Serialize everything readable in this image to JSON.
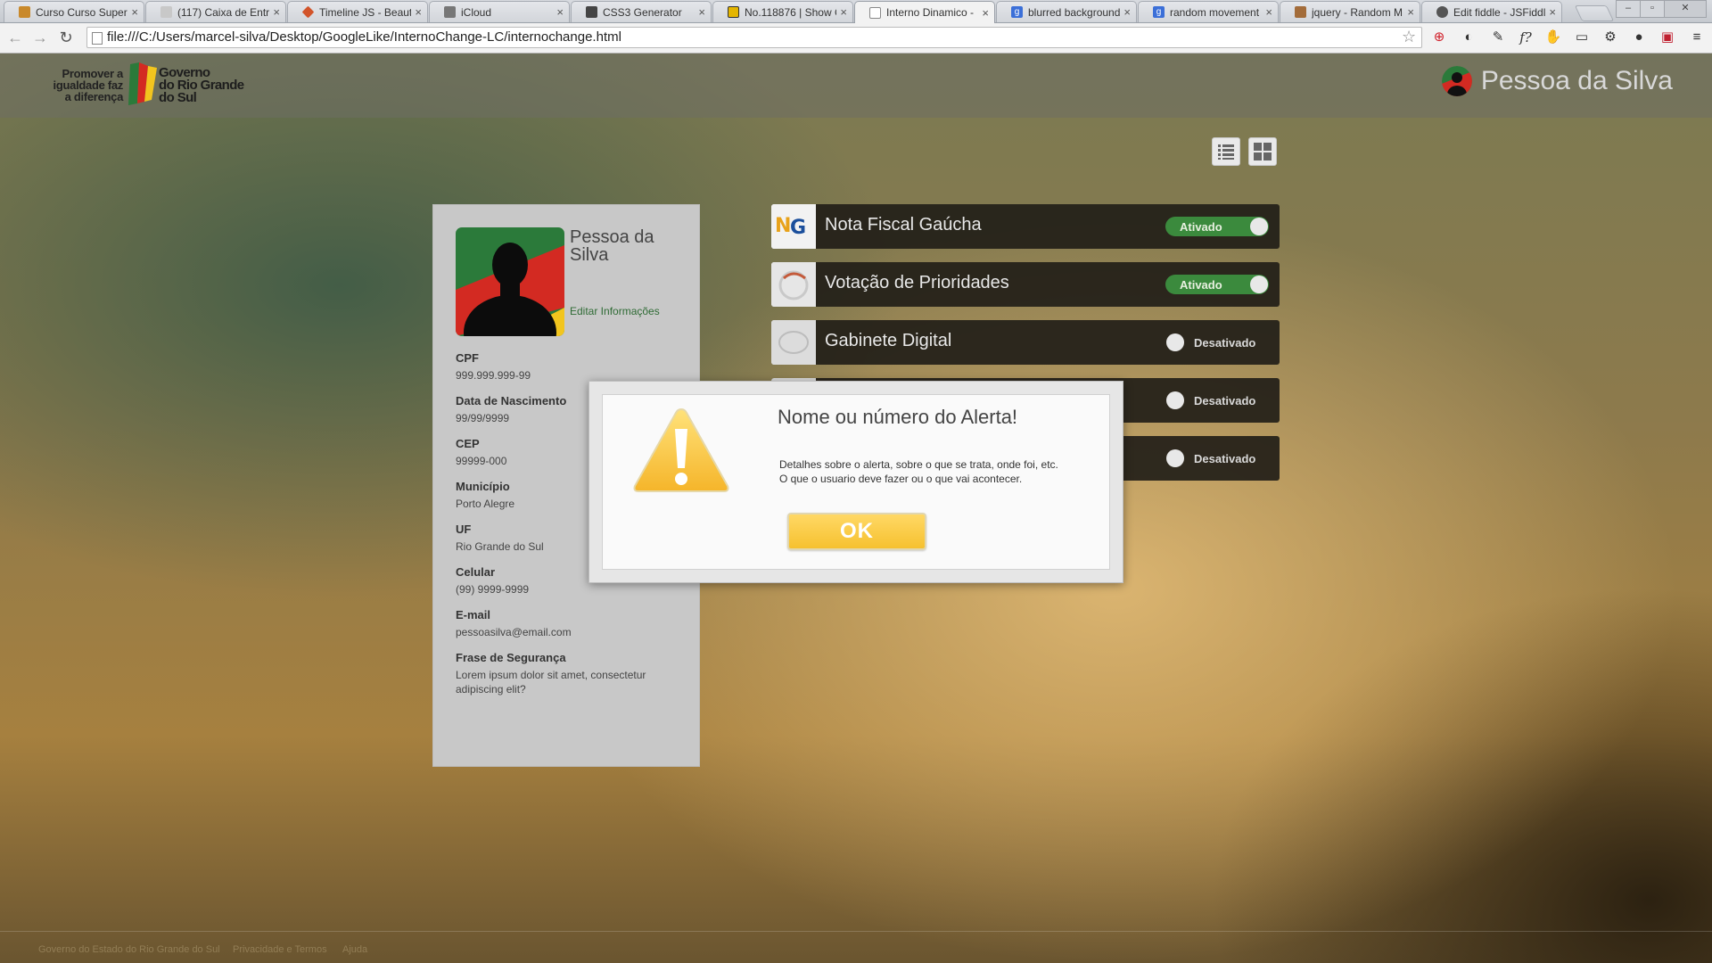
{
  "browser": {
    "tabs": [
      {
        "label": "Curso Curso Superi",
        "fav_color": "#c9892b",
        "active": false
      },
      {
        "label": "(117) Caixa de Entra",
        "fav_color": "#c8c8c8",
        "active": false
      },
      {
        "label": "Timeline JS - Beaut",
        "fav_color": "#d2542a",
        "active": false
      },
      {
        "label": "iCloud",
        "fav_color": "#777777",
        "active": false
      },
      {
        "label": "CSS3 Generator",
        "fav_color": "#444444",
        "active": false
      },
      {
        "label": "No.118876 | Show C",
        "fav_color": "#e4b500",
        "active": false
      },
      {
        "label": "Interno Dinamico -",
        "fav_color": "#ffffff",
        "active": true
      },
      {
        "label": "blurred background",
        "fav_color": "#3b6fd8",
        "active": false
      },
      {
        "label": "random movement",
        "fav_color": "#3b6fd8",
        "active": false
      },
      {
        "label": "jquery - Random M",
        "fav_color": "#a36c3a",
        "active": false
      },
      {
        "label": "Edit fiddle - JSFiddl",
        "fav_color": "#555555",
        "active": false
      }
    ],
    "url": "file:///C:/Users/marcel-silva/Desktop/GoogleLike/InternoChange-LC/internochange.html"
  },
  "header": {
    "slogan": [
      "Promover a",
      "igualdade faz",
      "a diferença"
    ],
    "gov_name": [
      "Governo",
      "do Rio Grande",
      "do Sul"
    ],
    "user_name": "Pessoa da Silva"
  },
  "profile": {
    "name": "Pessoa da Silva",
    "edit_label": "Editar Informações",
    "fields": [
      {
        "label": "CPF",
        "value": "999.999.999-99"
      },
      {
        "label": "Data de Nascimento",
        "value": "99/99/9999"
      },
      {
        "label": "CEP",
        "value": "99999-000"
      },
      {
        "label": "Município",
        "value": "Porto Alegre"
      },
      {
        "label": "UF",
        "value": "Rio Grande do Sul"
      },
      {
        "label": "Celular",
        "value": "(99) 9999-9999"
      },
      {
        "label": "E-mail",
        "value": "pessoasilva@email.com"
      },
      {
        "label": "Frase de Segurança",
        "value": "Lorem ipsum dolor sit amet, consectetur adipiscing elit?"
      }
    ]
  },
  "services": [
    {
      "name": "Nota Fiscal Gaúcha",
      "status": "Ativado",
      "on": true
    },
    {
      "name": "Votação de Prioridades",
      "status": "Ativado",
      "on": true
    },
    {
      "name": "Gabinete Digital",
      "status": "Desativado",
      "on": false
    },
    {
      "name": "",
      "status": "Desativado",
      "on": false
    },
    {
      "name": "",
      "status": "Desativado",
      "on": false
    }
  ],
  "alert": {
    "title": "Nome ou número do Alerta!",
    "body_line1": "Detalhes sobre o alerta, sobre o que se trata, onde foi, etc.",
    "body_line2": "O que o usuario deve fazer ou o que vai acontecer.",
    "ok_label": "OK"
  },
  "footer": {
    "links": [
      "Governo do Estado do Rio Grande do Sul",
      "Privacidade e Termos",
      "Ajuda"
    ]
  },
  "colors": {
    "toggle_on": "#3b8a3d",
    "ok_button": "#f6c12f",
    "link_green": "#2f6b35"
  }
}
